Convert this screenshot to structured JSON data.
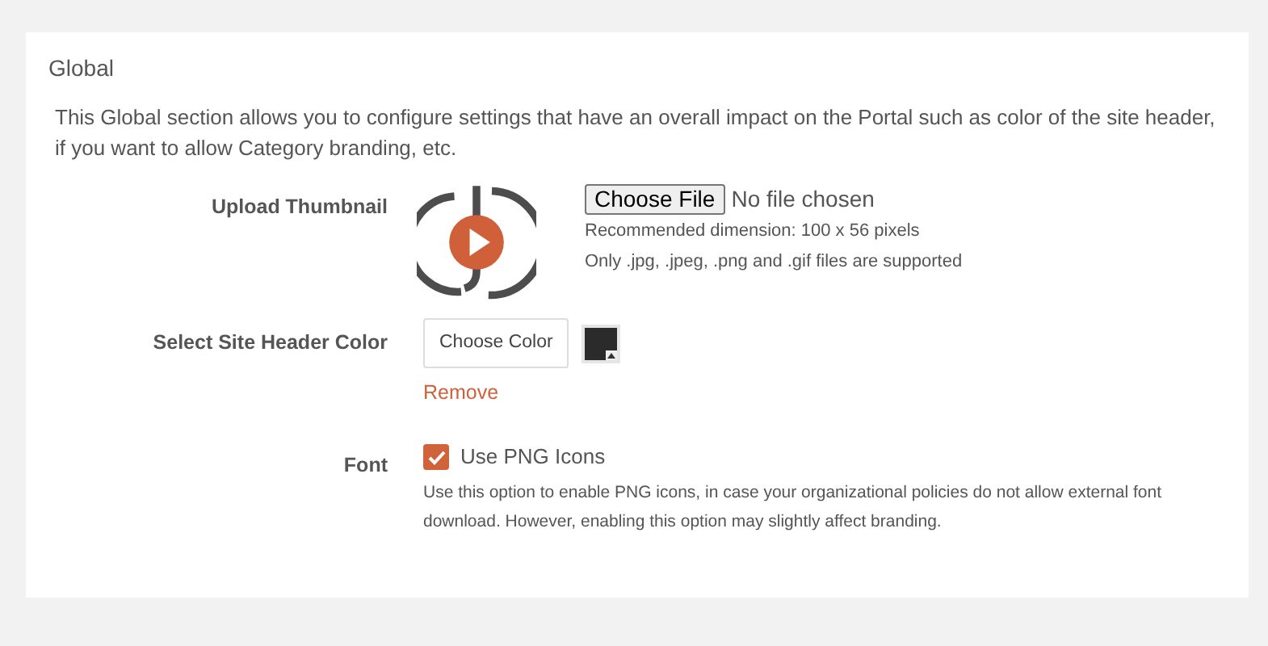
{
  "section": {
    "title": "Global",
    "description": "This Global section allows you to configure settings that have an overall impact on the Portal such as color of the site header, if you want to allow Category branding, etc."
  },
  "settings": [
    {
      "kind": "upload",
      "label": "Upload Thumbnail",
      "button": "Choose File",
      "file_status": "No file chosen",
      "hints": [
        "Recommended dimension: 100 x 56 pixels",
        "Only .jpg, .jpeg, .png and .gif files are supported"
      ]
    },
    {
      "kind": "color",
      "label": "Select Site Header Color",
      "button": "Choose Color",
      "color": "#2b2b2b",
      "remove_link": "Remove"
    },
    {
      "kind": "checkbox",
      "label": "Font",
      "option": "Use PNG Icons",
      "checked": true,
      "help": "Use this option to enable PNG icons, in case your organizational policies do not allow external font download. However, enabling this option may slightly affect branding."
    }
  ]
}
